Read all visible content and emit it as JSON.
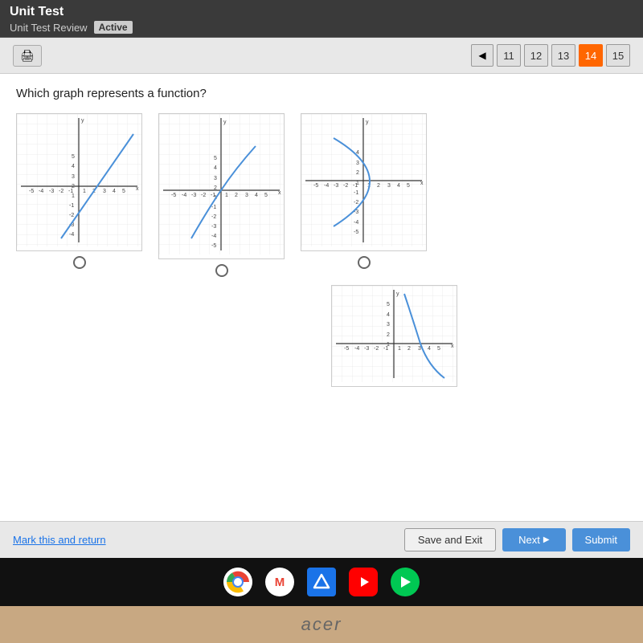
{
  "header": {
    "title": "Unit Test",
    "breadcrumb": "Unit Test Review",
    "status": "Active"
  },
  "nav": {
    "print_label": "🖨",
    "pages": [
      "11",
      "12",
      "13",
      "14",
      "15"
    ],
    "active_page": "14"
  },
  "question": {
    "text": "Which graph represents a function?"
  },
  "options": [
    {
      "id": "A",
      "radio": false
    },
    {
      "id": "B",
      "radio": false
    },
    {
      "id": "C",
      "radio": false
    },
    {
      "id": "D",
      "radio": false
    }
  ],
  "actions": {
    "mark_return": "Mark this and return",
    "save_exit": "Save and Exit",
    "next": "Next",
    "submit": "Submit"
  },
  "taskbar": {
    "icons": [
      "chrome",
      "gmail",
      "drive",
      "youtube",
      "play"
    ]
  },
  "acer": "acer"
}
